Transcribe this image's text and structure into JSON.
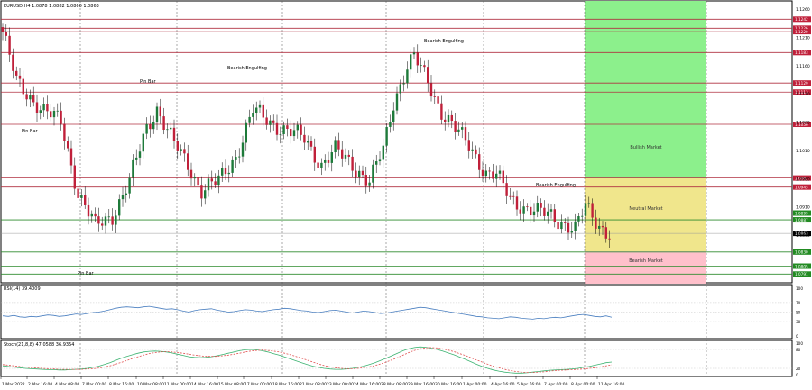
{
  "chart_data": {
    "type": "candlestick",
    "symbol_line": "EURUSD,H4  1.0878 1.0882 1.0860 1.0863",
    "y_ticks": [
      "1.1260",
      "1.1210",
      "1.1160",
      "1.1110",
      "1.1060",
      "1.1010",
      "1.0960",
      "1.0910",
      "1.0860"
    ],
    "x_ticks": [
      "1 Mar 2022",
      "2 Mar 16:00",
      "4 Mar 08:00",
      "7 Mar 00:00",
      "8 Mar 16:00",
      "10 Mar 08:00",
      "11 Mar 00:00",
      "14 Mar 16:00",
      "15 Mar 08:00",
      "17 Mar 00:00",
      "18 Mar 16:00",
      "21 Mar 08:00",
      "23 Mar 00:00",
      "24 Mar 16:00",
      "28 Mar 08:00",
      "29 Mar 16:00",
      "30 Mar 16:00",
      "1 Apr 00:00",
      "4 Apr 16:00",
      "5 Apr 16:00",
      "7 Apr 00:00",
      "8 Apr 00:00",
      "11 Apr 16:00"
    ],
    "resistance_levels": [
      "1.1242",
      "1.1226",
      "1.1220",
      "1.1183",
      "1.1129",
      "1.1113",
      "1.1056",
      "1.0961",
      "1.0945"
    ],
    "support_levels": [
      "1.0899",
      "1.0887",
      "1.0830",
      "1.0805",
      "1.0791"
    ],
    "current_price": "1.0863",
    "zones": [
      {
        "name": "Bullish Market",
        "color": "#8cf08c"
      },
      {
        "name": "Neutral Market",
        "color": "#f0e68c"
      },
      {
        "name": "Bearish Market",
        "color": "#ffc0cb"
      }
    ],
    "pattern_labels": [
      {
        "text": "Pin Bar",
        "bar": 4
      },
      {
        "text": "Pin Bar",
        "bar": 27
      },
      {
        "text": "Pin Bar",
        "bar": 15
      },
      {
        "text": "Bearish Engulfing",
        "bar": 48
      },
      {
        "text": "Bearish Engulfing",
        "bar": 90
      },
      {
        "text": "Bearish Engulfing",
        "bar": 111
      }
    ],
    "rsi": {
      "label": "RSI(14) 39.4009",
      "scale": [
        "100",
        "70",
        "50",
        "30",
        "0"
      ],
      "values": [
        42,
        41,
        43,
        40,
        39,
        41,
        40,
        42,
        44,
        43,
        41,
        42,
        44,
        46,
        45,
        47,
        49,
        50,
        52,
        55,
        58,
        60,
        61,
        60,
        59,
        61,
        62,
        60,
        58,
        56,
        57,
        55,
        52,
        50,
        53,
        55,
        56,
        57,
        54,
        52,
        50,
        51,
        53,
        55,
        54,
        52,
        51,
        53,
        55,
        56,
        58,
        57,
        55,
        53,
        52,
        50,
        49,
        51,
        53,
        54,
        52,
        50,
        48,
        50,
        52,
        51,
        49,
        47,
        48,
        50,
        52,
        54,
        56,
        58,
        60,
        59,
        57,
        55,
        53,
        51,
        49,
        47,
        45,
        43,
        41,
        40,
        38,
        37,
        36,
        38,
        40,
        39,
        37,
        36,
        35,
        37,
        36,
        38,
        39,
        38,
        40,
        42,
        44,
        45,
        43,
        41,
        40,
        42,
        39
      ]
    },
    "stoch": {
      "label": "Stoch(21,8,8) 47.0588 36.9354",
      "scale": [
        "100",
        "80",
        "20",
        "0"
      ],
      "main": [
        28,
        26,
        24,
        22,
        20,
        19,
        18,
        17,
        16,
        16,
        15,
        15,
        16,
        17,
        18,
        20,
        23,
        27,
        32,
        38,
        45,
        52,
        58,
        63,
        68,
        72,
        74,
        75,
        74,
        72,
        69,
        65,
        61,
        57,
        55,
        54,
        55,
        57,
        60,
        64,
        68,
        72,
        76,
        79,
        80,
        79,
        76,
        72,
        67,
        62,
        56,
        50,
        44,
        38,
        32,
        27,
        23,
        20,
        18,
        17,
        17,
        18,
        20,
        23,
        27,
        32,
        38,
        45,
        52,
        60,
        68,
        76,
        82,
        86,
        88,
        87,
        84,
        80,
        75,
        69,
        63,
        56,
        49,
        41,
        33,
        26,
        20,
        15,
        11,
        8,
        6,
        5,
        5,
        6,
        8,
        10,
        12,
        14,
        15,
        16,
        17,
        18,
        20,
        23,
        26,
        30,
        34,
        38,
        40
      ],
      "signal": [
        32,
        30,
        28,
        26,
        24,
        22,
        21,
        20,
        19,
        18,
        17,
        17,
        17,
        17,
        17,
        18,
        19,
        21,
        24,
        28,
        33,
        39,
        45,
        51,
        57,
        62,
        67,
        70,
        72,
        73,
        72,
        70,
        68,
        65,
        62,
        60,
        58,
        58,
        58,
        60,
        62,
        65,
        68,
        72,
        75,
        77,
        78,
        77,
        75,
        72,
        68,
        63,
        58,
        52,
        46,
        40,
        34,
        29,
        25,
        22,
        20,
        19,
        19,
        20,
        22,
        25,
        29,
        34,
        40,
        47,
        54,
        62,
        70,
        77,
        82,
        85,
        86,
        85,
        82,
        78,
        73,
        67,
        61,
        54,
        47,
        40,
        33,
        27,
        22,
        17,
        13,
        10,
        8,
        7,
        7,
        8,
        9,
        11,
        13,
        14,
        15,
        16,
        17,
        18,
        20,
        22,
        25,
        28,
        31
      ]
    }
  }
}
